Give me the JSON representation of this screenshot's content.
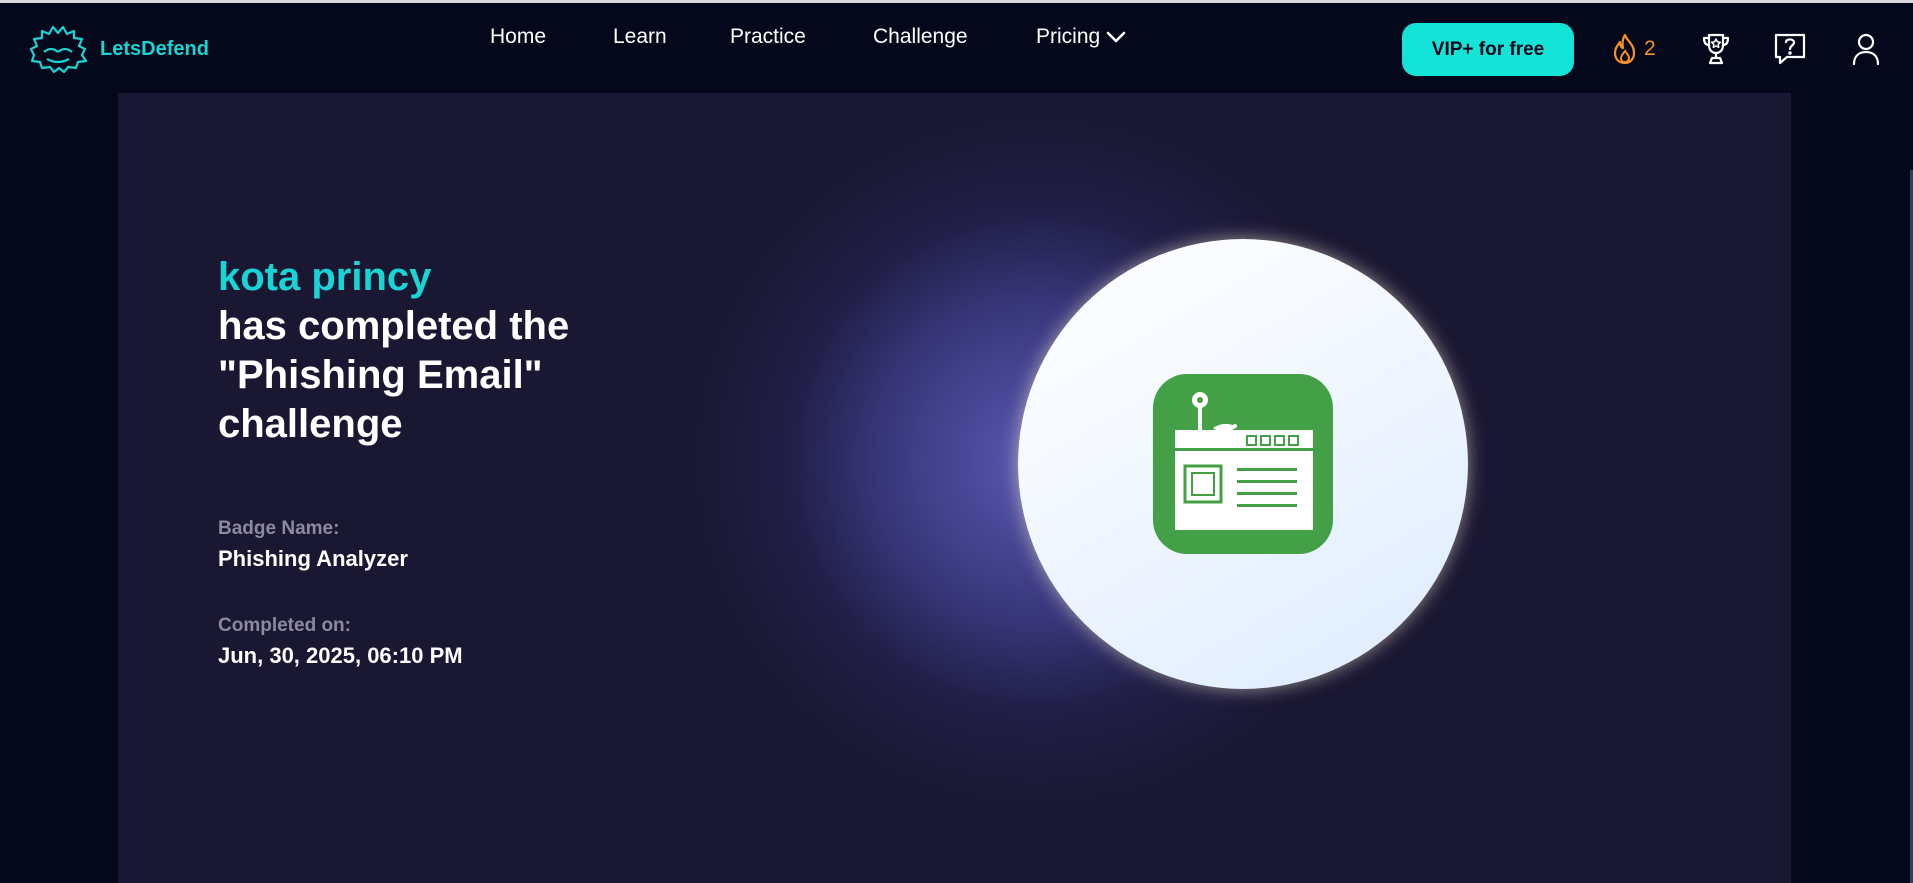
{
  "brand": {
    "name": "LetsDefend"
  },
  "nav": {
    "items": [
      {
        "label": "Home"
      },
      {
        "label": "Learn"
      },
      {
        "label": "Practice"
      },
      {
        "label": "Challenge"
      },
      {
        "label": "Pricing"
      }
    ],
    "vip_label": "VIP+ for free",
    "streak_count": "2"
  },
  "certificate": {
    "user_name": "kota princy",
    "headline": "has completed the\n\"Phishing Email\"\nchallenge",
    "badge_label": "Badge Name:",
    "badge_name": "Phishing Analyzer",
    "completed_label": "Completed on:",
    "completed_on": "Jun, 30, 2025, 06:10 PM"
  },
  "colors": {
    "accent": "#14e3d8",
    "streak": "#f5912b",
    "badge_green": "#43a047",
    "background": "#05081a",
    "card": "#1a1733"
  },
  "icons": [
    "letsdefend-logo-icon",
    "chevron-down-icon",
    "fire-icon",
    "trophy-icon",
    "help-icon",
    "profile-icon",
    "phishing-badge-icon"
  ]
}
